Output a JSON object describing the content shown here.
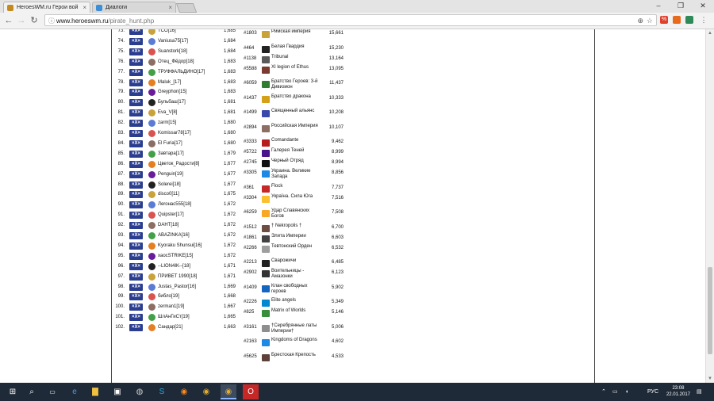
{
  "browser": {
    "tabs": [
      {
        "title": "HeroesWM.ru Герои вой",
        "active": true
      },
      {
        "title": "Диалоги",
        "active": false
      }
    ],
    "url_host": "www.heroeswm.ru",
    "url_path": "/pirate_hunt.php",
    "window_controls": {
      "min": "–",
      "max": "❐",
      "close": "✕"
    },
    "nav": {
      "back": "←",
      "forward": "→",
      "reload": "↻"
    }
  },
  "players": [
    {
      "rank": "73.",
      "nick": "TCO[16]",
      "score": "1,685"
    },
    {
      "rank": "74.",
      "nick": "Vaniusa75[17]",
      "score": "1,684"
    },
    {
      "rank": "75.",
      "nick": "Suanstork[18]",
      "score": "1,684"
    },
    {
      "rank": "76.",
      "nick": "Отец_Фёдор[18]",
      "score": "1,683"
    },
    {
      "rank": "77.",
      "nick": "ТРУФФАЛЬДИНО[17]",
      "score": "1,683"
    },
    {
      "rank": "78.",
      "nick": "Maluk_[17]",
      "score": "1,683"
    },
    {
      "rank": "79.",
      "nick": "Greyphon[15]",
      "score": "1,683"
    },
    {
      "rank": "80.",
      "nick": "Бульбаш[17]",
      "score": "1,681"
    },
    {
      "rank": "81.",
      "nick": "Eva_V[8]",
      "score": "1,681"
    },
    {
      "rank": "82.",
      "nick": "zarm[15]",
      "score": "1,680"
    },
    {
      "rank": "83.",
      "nick": "Komissar78[17]",
      "score": "1,680"
    },
    {
      "rank": "84.",
      "nick": "El Furia[17]",
      "score": "1,680"
    },
    {
      "rank": "85.",
      "nick": "Завтара[17]",
      "score": "1,679"
    },
    {
      "rank": "86.",
      "nick": "Цветок_Радости[8]",
      "score": "1,677"
    },
    {
      "rank": "87.",
      "nick": "Penguin[19]",
      "score": "1,677"
    },
    {
      "rank": "88.",
      "nick": "Solerei[18]",
      "score": "1,677"
    },
    {
      "rank": "89.",
      "nick": "disco0[11]",
      "score": "1,675"
    },
    {
      "rank": "90.",
      "nick": "Лeroнас555[18]",
      "score": "1,672"
    },
    {
      "rank": "91.",
      "nick": "Quipster[17]",
      "score": "1,672"
    },
    {
      "rank": "92.",
      "nick": "DAHT[18]",
      "score": "1,672"
    },
    {
      "rank": "93.",
      "nick": "ABAZINKA[16]",
      "score": "1,672"
    },
    {
      "rank": "94.",
      "nick": "Kyoraku Shunsui[16]",
      "score": "1,672"
    },
    {
      "rank": "95.",
      "nick": "xaocSTRIKE[15]",
      "score": "1,672"
    },
    {
      "rank": "96.",
      "nick": "--LION4IK--[18]",
      "score": "1,671"
    },
    {
      "rank": "97.",
      "nick": "ПРИВЕТ 1990[18]",
      "score": "1,671"
    },
    {
      "rank": "98.",
      "nick": "Justas_Pastor[16]",
      "score": "1,669"
    },
    {
      "rank": "99.",
      "nick": "библо[19]",
      "score": "1,668"
    },
    {
      "rank": "100.",
      "nick": "zerman1[19]",
      "score": "1,667"
    },
    {
      "rank": "101.",
      "nick": "ШлАнГиСт[19]",
      "score": "1,665"
    },
    {
      "rank": "102.",
      "nick": "Сандар[21]",
      "score": "1,663"
    }
  ],
  "clans": [
    {
      "id": "#1803",
      "name": "Римская империя",
      "score": "15,661",
      "color": "#c9a23a"
    },
    {
      "id": "#464",
      "name": "Белая Гвардия",
      "score": "15,230",
      "color": "#222222"
    },
    {
      "id": "#1138",
      "name": "Tribunal",
      "score": "13,164",
      "color": "#5a5a5a"
    },
    {
      "id": "#5588",
      "name": "XI legion of Ethus",
      "score": "13,095",
      "color": "#7a3b2e"
    },
    {
      "id": "#6059",
      "name": "Братство Героев: 3-й Дивизион",
      "score": "11,437",
      "color": "#2e7d32"
    },
    {
      "id": "#1437",
      "name": "Братство дракона",
      "score": "10,333",
      "color": "#d4a017"
    },
    {
      "id": "#1499",
      "name": "Священный альянс",
      "score": "10,208",
      "color": "#3949ab"
    },
    {
      "id": "#2894",
      "name": "Российская Империя",
      "score": "10,107",
      "color": "#8d6e63"
    },
    {
      "id": "#3333",
      "name": "Comandante",
      "score": "9,462",
      "color": "#b71c1c"
    },
    {
      "id": "#5722",
      "name": "Галерея Теней",
      "score": "8,999",
      "color": "#4a148c"
    },
    {
      "id": "#2745",
      "name": "Черный Отряд",
      "score": "8,994",
      "color": "#111111"
    },
    {
      "id": "#3305",
      "name": "Украина. Великие Запада",
      "score": "8,856",
      "color": "#1e88e5"
    },
    {
      "id": "#361",
      "name": "Flock",
      "score": "7,737",
      "color": "#c62828"
    },
    {
      "id": "#3304",
      "name": "Україна. Сила Юга",
      "score": "7,516",
      "color": "#fbc02d"
    },
    {
      "id": "#6259",
      "name": "Удар Славянских Богов",
      "score": "7,508",
      "color": "#f9a825"
    },
    {
      "id": "#1512",
      "name": "† Nekropolis †",
      "score": "6,700",
      "color": "#6d4c41"
    },
    {
      "id": "#1861",
      "name": "Элита Империи",
      "score": "6,603",
      "color": "#424242"
    },
    {
      "id": "#2266",
      "name": "Тевтонский Орден",
      "score": "6,532",
      "color": "#9e9e9e"
    },
    {
      "id": "#2213",
      "name": "Сварожичи",
      "score": "6,485",
      "color": "#212121"
    },
    {
      "id": "#2902",
      "name": "Воительницы - Амазонки",
      "score": "6,123",
      "color": "#333333"
    },
    {
      "id": "#1409",
      "name": "Клан свободных героев",
      "score": "5,902",
      "color": "#1565c0"
    },
    {
      "id": "#2226",
      "name": "Elite angels",
      "score": "5,349",
      "color": "#0288d1"
    },
    {
      "id": "#825",
      "name": "Matrix of Worlds",
      "score": "5,146",
      "color": "#388e3c"
    },
    {
      "id": "#3161",
      "name": "†Серебрянные латы Империи†",
      "score": "5,006",
      "color": "#8e8e8e"
    },
    {
      "id": "#2163",
      "name": "Kingdoms of Dragons",
      "score": "4,602",
      "color": "#1e88e5"
    },
    {
      "id": "#5625",
      "name": "Брестская Крепость",
      "score": "4,533",
      "color": "#5d4037"
    }
  ],
  "guild_badge": "×X×",
  "taskbar": {
    "lang": "РУС",
    "time": "23:08",
    "date": "22.01.2017",
    "start": "⊞",
    "search": "⌕"
  }
}
